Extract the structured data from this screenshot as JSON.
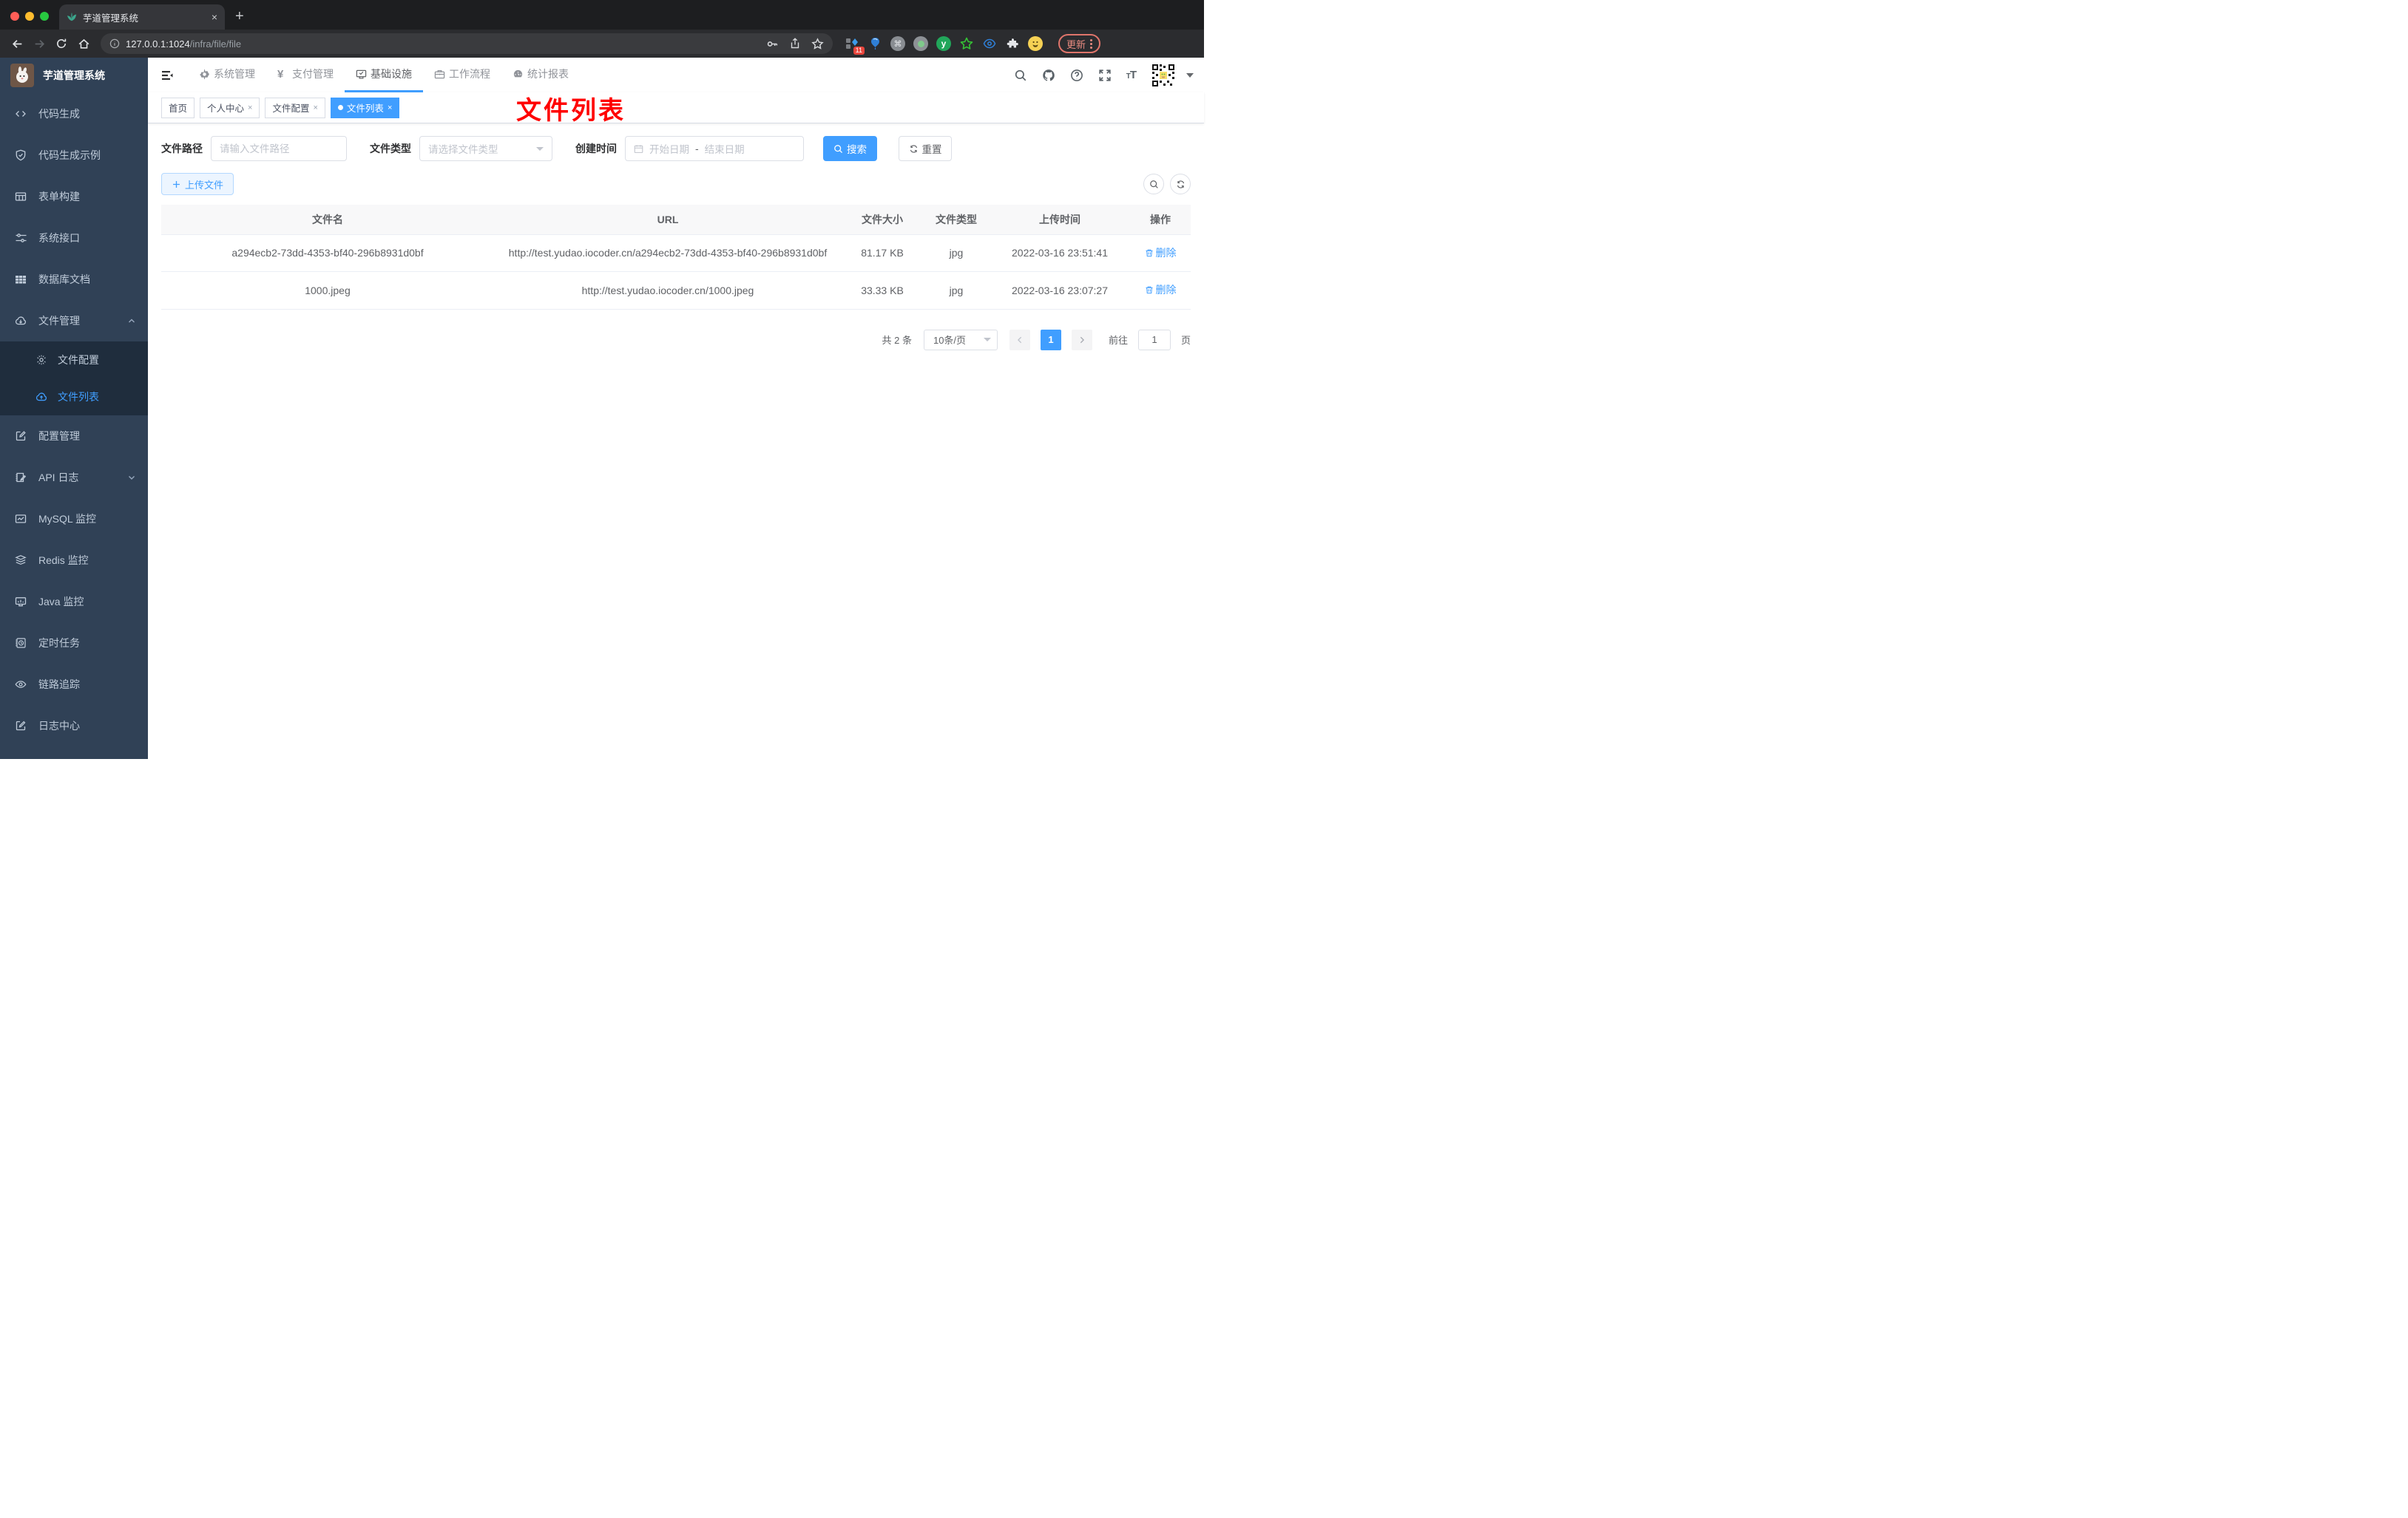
{
  "browser": {
    "tab_title": "芋道管理系统",
    "tab_close": "×",
    "new_tab": "+",
    "url_host": "127.0.0.1:1024",
    "url_path": "/infra/file/file",
    "ext_badge": "11",
    "update_label": "更新"
  },
  "sidebar": {
    "title": "芋道管理系统",
    "items": [
      {
        "label": "代码生成"
      },
      {
        "label": "代码生成示例"
      },
      {
        "label": "表单构建"
      },
      {
        "label": "系统接口"
      },
      {
        "label": "数据库文档"
      },
      {
        "label": "文件管理"
      },
      {
        "label": "文件配置"
      },
      {
        "label": "文件列表"
      },
      {
        "label": "配置管理"
      },
      {
        "label": "API 日志"
      },
      {
        "label": "MySQL 监控"
      },
      {
        "label": "Redis 监控"
      },
      {
        "label": "Java 监控"
      },
      {
        "label": "定时任务"
      },
      {
        "label": "链路追踪"
      },
      {
        "label": "日志中心"
      }
    ]
  },
  "topnav": {
    "items": [
      {
        "label": "系统管理"
      },
      {
        "label": "支付管理"
      },
      {
        "label": "基础设施"
      },
      {
        "label": "工作流程"
      },
      {
        "label": "统计报表"
      }
    ]
  },
  "tags": {
    "items": [
      {
        "label": "首页"
      },
      {
        "label": "个人中心"
      },
      {
        "label": "文件配置"
      },
      {
        "label": "文件列表"
      }
    ],
    "close": "×"
  },
  "annotation": {
    "text": "文件列表"
  },
  "filters": {
    "path_label": "文件路径",
    "path_placeholder": "请输入文件路径",
    "type_label": "文件类型",
    "type_placeholder": "请选择文件类型",
    "date_label": "创建时间",
    "date_start": "开始日期",
    "date_sep": "-",
    "date_end": "结束日期",
    "search_label": "搜索",
    "reset_label": "重置"
  },
  "toolbar": {
    "upload_label": "上传文件"
  },
  "table": {
    "headers": [
      "文件名",
      "URL",
      "文件大小",
      "文件类型",
      "上传时间",
      "操作"
    ],
    "rows": [
      {
        "name": "a294ecb2-73dd-4353-bf40-296b8931d0bf",
        "url": "http://test.yudao.iocoder.cn/a294ecb2-73dd-4353-bf40-296b8931d0bf",
        "size": "81.17 KB",
        "type": "jpg",
        "time": "2022-03-16 23:51:41",
        "action": "删除"
      },
      {
        "name": "1000.jpeg",
        "url": "http://test.yudao.iocoder.cn/1000.jpeg",
        "size": "33.33 KB",
        "type": "jpg",
        "time": "2022-03-16 23:07:27",
        "action": "删除"
      }
    ]
  },
  "pagination": {
    "total": "共 2 条",
    "page_size": "10条/页",
    "current": "1",
    "goto_label": "前往",
    "goto_value": "1",
    "unit": "页"
  },
  "colors": {
    "accent": "#409eff",
    "sidebar_bg": "#304156",
    "submenu_bg": "#1f2d3d",
    "sidebar_text": "#bfcbd9",
    "annotation": "#ff0000"
  }
}
